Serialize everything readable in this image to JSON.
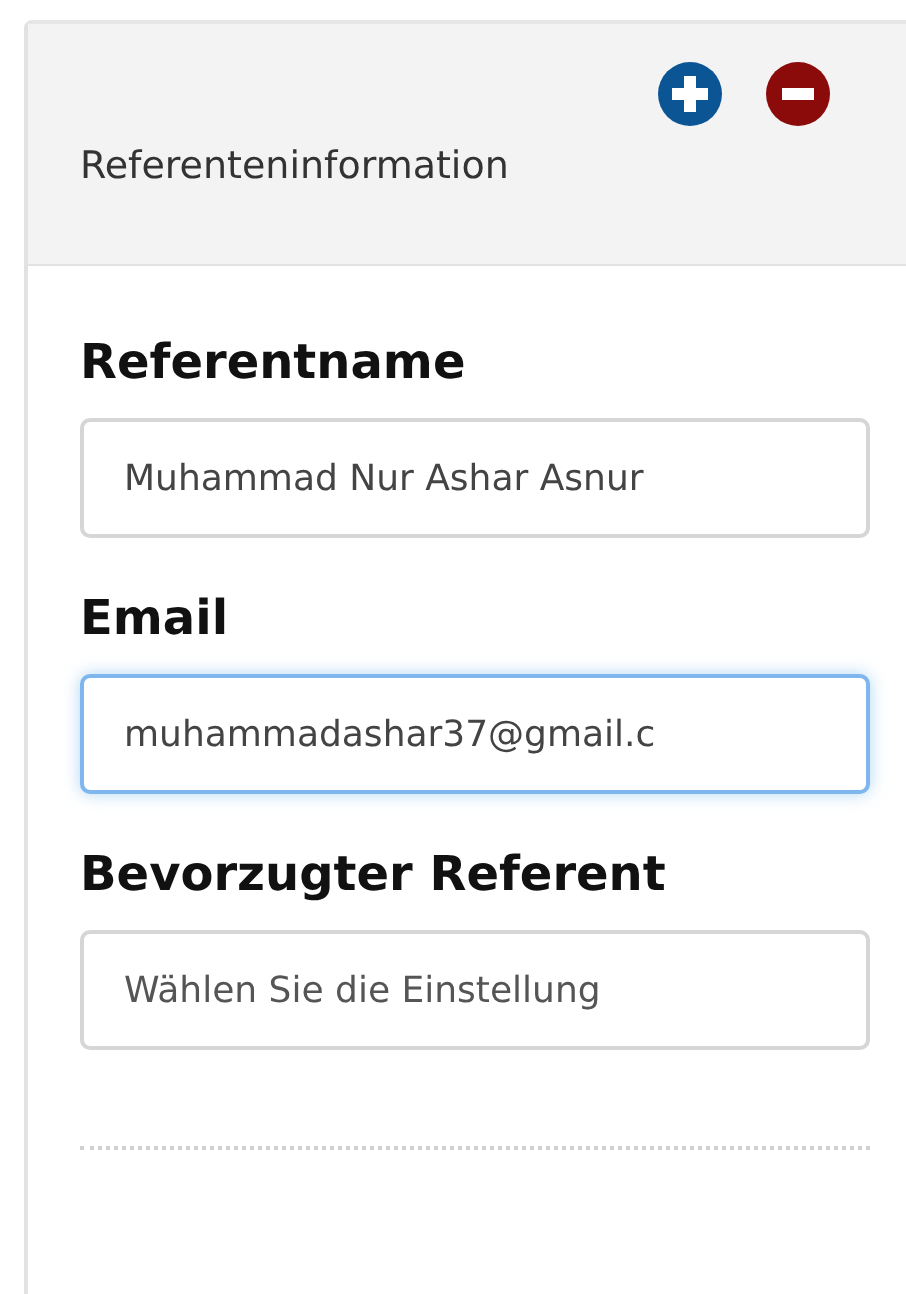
{
  "panel": {
    "title": "Referenteninformation"
  },
  "fields": [
    {
      "label": "Referentname",
      "value": "Muhammad Nur Ashar Asnur",
      "focused": false
    },
    {
      "label": "Email",
      "value": "muhammadashar37@gmail.c",
      "focused": true
    },
    {
      "label": "Bevorzugter Referent",
      "placeholder": "Wählen Sie die Einstellung",
      "focused": false
    }
  ]
}
